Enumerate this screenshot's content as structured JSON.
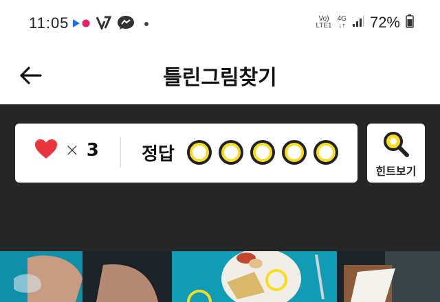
{
  "status_bar": {
    "time": "11:05",
    "network_top": "Vo)",
    "network_bottom": "LTE1",
    "data_top": "4G",
    "data_bottom": "↓↑",
    "battery_percent": "72%",
    "icons": [
      "flickr-dots-icon",
      "v-checkmark-icon",
      "messenger-icon",
      "dot-icon",
      "signal-icon",
      "battery-icon"
    ]
  },
  "header": {
    "title": "틀린그림찾기",
    "back_icon": "arrow-left-icon"
  },
  "game": {
    "lives_x": "×",
    "lives_count": "3",
    "answer_label": "정답",
    "answers_found": 0,
    "answers_total": 5,
    "hint_label": "힌트보기",
    "colors": {
      "circle_fill": "#f7dd22",
      "heart": "#e8343a",
      "background": "#262626"
    }
  }
}
